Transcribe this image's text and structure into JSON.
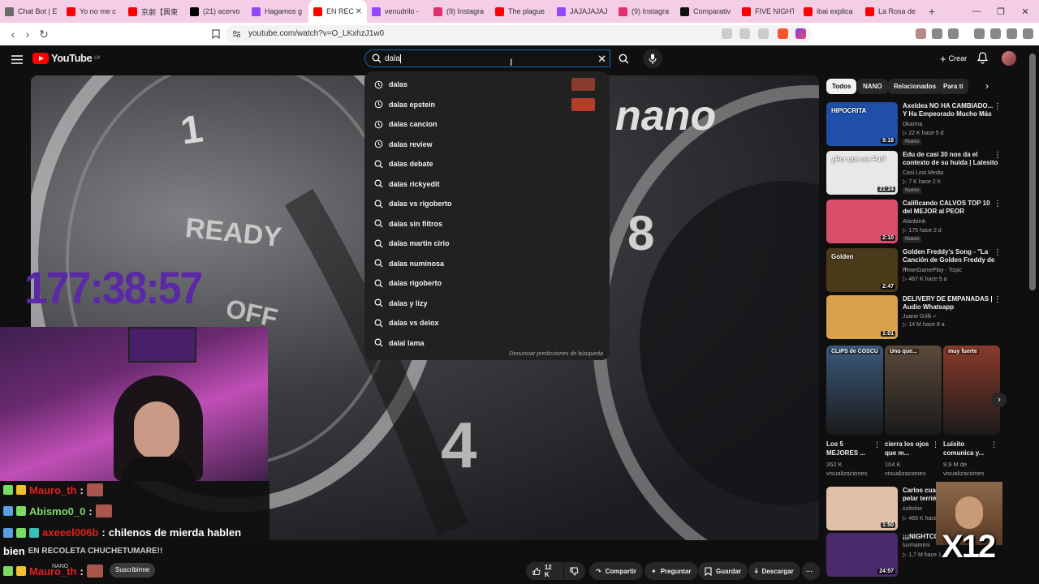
{
  "browser": {
    "tabs": [
      {
        "label": "Chat Bot | E",
        "color": "#6b6b6b"
      },
      {
        "label": "Yo no me c",
        "color": "#ff0000"
      },
      {
        "label": "京劇【興東",
        "color": "#ff0000"
      },
      {
        "label": "(21) acervo",
        "color": "#000000"
      },
      {
        "label": "Hagamos g",
        "color": "#9146ff"
      },
      {
        "label": "EN REC",
        "color": "#ff0000"
      },
      {
        "label": "venudrilo -",
        "color": "#9146ff"
      },
      {
        "label": "(9) Instagra",
        "color": "#e1306c"
      },
      {
        "label": "The plague",
        "color": "#ff0000"
      },
      {
        "label": "JAJAJAJAJ",
        "color": "#9146ff"
      },
      {
        "label": "(9) Instagra",
        "color": "#e1306c"
      },
      {
        "label": "Comparativ",
        "color": "#111111"
      },
      {
        "label": "FIVE NIGHT",
        "color": "#ff0000"
      },
      {
        "label": "ibai explica",
        "color": "#ff0000"
      },
      {
        "label": "La Rosa de",
        "color": "#ff0000"
      }
    ],
    "active_tab": 5,
    "new_tab": "+",
    "url": "youtube.com/watch?v=O_LKxhzJ1w0"
  },
  "youtube": {
    "logo": "YouTube",
    "logo_region": "UY",
    "search_value": "dala",
    "create_label": "Crear"
  },
  "suggestions": {
    "items": [
      {
        "text": "dalas",
        "type": "history",
        "thumb": "#8a3b2d"
      },
      {
        "text": "dalas epstein",
        "type": "history",
        "thumb": "#b53c28"
      },
      {
        "text": "dalas cancion",
        "type": "history"
      },
      {
        "text": "dalas review",
        "type": "history"
      },
      {
        "text": "dalas debate",
        "type": "search"
      },
      {
        "text": "dalas rickyedit",
        "type": "search"
      },
      {
        "text": "dalas vs rigoberto",
        "type": "search"
      },
      {
        "text": "dalas sin filtros",
        "type": "search"
      },
      {
        "text": "dalas martin cirio",
        "type": "search"
      },
      {
        "text": "dalas numinosa",
        "type": "search"
      },
      {
        "text": "dalas rigoberto",
        "type": "search"
      },
      {
        "text": "dalas y lizy",
        "type": "search"
      },
      {
        "text": "dalas vs delox",
        "type": "search"
      },
      {
        "text": "dalai lama",
        "type": "search"
      }
    ],
    "report": "Denunciar predicciones de búsqueda"
  },
  "video": {
    "timer": "177:38:57",
    "gauge_labels": [
      "1",
      "READY",
      "OFF",
      "8",
      "4",
      "nano"
    ]
  },
  "chips": [
    "Todos",
    "NANO",
    "Relacionados",
    "Para ti"
  ],
  "recommendations": [
    {
      "title": "Axeldea NO HA CAMBIADO... Y Ha Empeorado Mucho Más",
      "channel": "Dkarma",
      "meta": "▷ 22 K  hace 5 d",
      "badge": "Nuevo",
      "duration": "9:18",
      "thumb": "#1f4fa8",
      "thumb_text": "HIPOCRITA"
    },
    {
      "title": "Edu de casi 30 nos da el contexto de su huida | Latesito",
      "channel": "Casi Lost Media",
      "meta": "▷ 7 K  hace 2 h",
      "badge": "Nuevo",
      "duration": "21:24",
      "thumb": "#e8e8e8",
      "thumb_text": "¿Por que me Fui?"
    },
    {
      "title": "Calificando CALVOS TOP 10 del MEJOR al PEOR",
      "channel": "Alanbiink",
      "meta": "▷ 175  hace 2 d",
      "badge": "Nuevo",
      "duration": "2:10",
      "thumb": "#d94f6b",
      "thumb_text": ""
    },
    {
      "title": "Golden Freddy's Song - \"La Canción de Golden Freddy de ...",
      "channel": "iTownGamePlay - Topic",
      "meta": "▷ 467 K  hace 5 a",
      "badge": "",
      "duration": "2:47",
      "thumb": "#4a3a1a",
      "thumb_text": "Golden"
    },
    {
      "title": "DELIVERY DE EMPANADAS | Audio Whatsapp",
      "channel": "Juane Grilli ✓",
      "meta": "▷ 14 M  hace 8 a",
      "badge": "",
      "duration": "1:01",
      "thumb": "#d8a24a",
      "thumb_text": ""
    }
  ],
  "shorts": [
    {
      "title": "Los 5 MEJORES ...",
      "views": "262 K visualizaciones",
      "thumb": "#3a5a7a",
      "caption": "CLIPS de COSCU"
    },
    {
      "title": "cierra los ojos que m...",
      "views": "104 K visualizaciones",
      "thumb": "#5a4a3a",
      "caption": "Uno que..."
    },
    {
      "title": "Luisito comunica y...",
      "views": "9,9 M de visualizaciones",
      "thumb": "#8a3a2a",
      "caption": "muy fuerte"
    }
  ],
  "bottom_recs": [
    {
      "title": "Carlos cuand pelar terrié",
      "channel": "soltoloo",
      "meta": "▷ 465 K  hace",
      "duration": "1:50",
      "thumb": "#e0c0a8"
    },
    {
      "title": "¡¡¡NIGHTCOR",
      "channel": "luvmamimi",
      "meta": "▷ 1,7 M  hace 1",
      "duration": "24:57",
      "thumb": "#4a2a6a"
    }
  ],
  "overlay": {
    "x12": "X12",
    "chat": [
      {
        "name": "Mauro_th",
        "suffix": " :",
        "message": "",
        "name_color": "#e0211c"
      },
      {
        "name": "Abismo0_0",
        "suffix": " :",
        "message": "",
        "name_color": "#7bdc63"
      },
      {
        "name": "axeeel006b",
        "suffix": " :",
        "message": "chilenos de mierda hablen",
        "name_color": "#e0211c"
      },
      {
        "name": "",
        "suffix": "",
        "message": "bien",
        "name_color": "#ffffff"
      },
      {
        "name": "Mauro_th",
        "suffix": " :",
        "message": "",
        "name_color": "#e0211c"
      }
    ],
    "chat_sub": "EN RECOLETA CHUCHETUMARE!!",
    "channel_name": "NANO",
    "subscribe": "Suscribirme"
  },
  "actions": {
    "likes": "12 K",
    "share": "Compartir",
    "ask": "Preguntar",
    "save": "Guardar",
    "download": "Descargar",
    "more": "···"
  },
  "colors": {
    "tab_bar": "#f4cde6",
    "yt_bg": "#0f0f0f",
    "timer": "#5b28a8",
    "search_border": "#1c62b9"
  }
}
